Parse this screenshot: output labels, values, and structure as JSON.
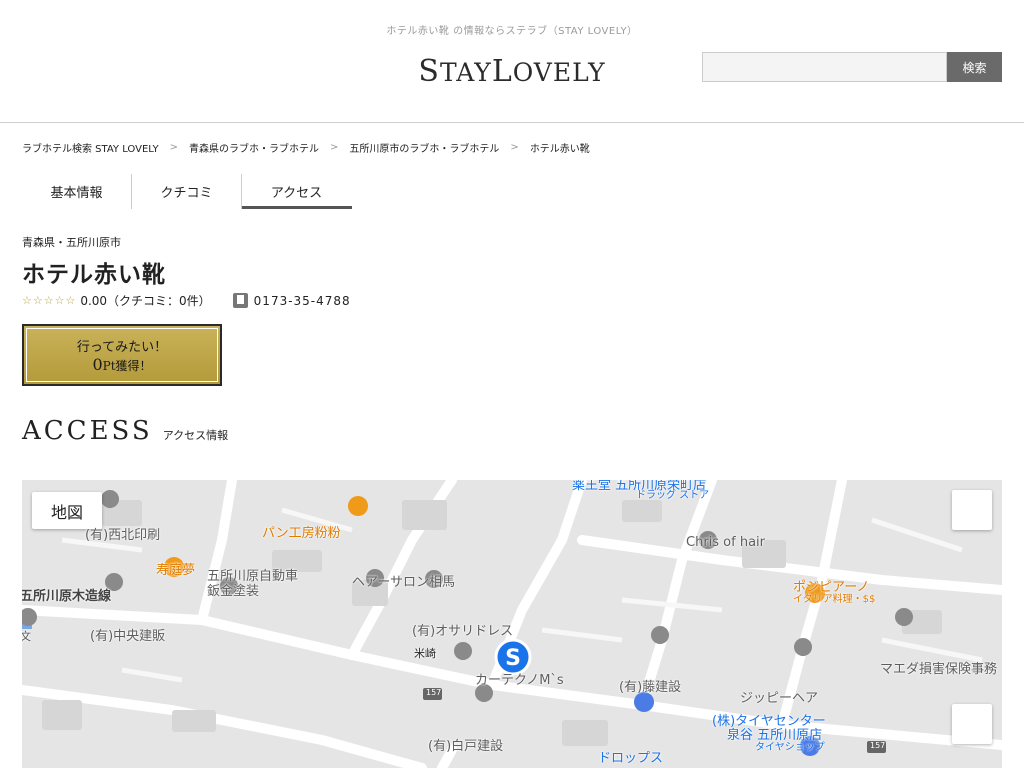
{
  "header": {
    "tagline": "ホテル赤い靴 の情報ならステラブ（STAY LOVELY）",
    "logo_first": "S",
    "logo_mid": "TAY",
    "logo_second": "L",
    "logo_rest": "OVELY",
    "search_placeholder": "",
    "search_button": "検索"
  },
  "breadcrumb": [
    "ラブホテル検索 STAY LOVELY",
    "青森県のラブホ・ラブホテル",
    "五所川原市のラブホ・ラブホテル",
    "ホテル赤い靴"
  ],
  "breadcrumb_sep": ">",
  "tabs": [
    "基本情報",
    "クチコミ",
    "アクセス"
  ],
  "hotel": {
    "prefecture": "青森県・五所川原市",
    "name": "ホテル赤い靴",
    "stars": "☆☆☆☆☆",
    "rating": "0.00（クチコミ：0件）",
    "phone": "0173-35-4788"
  },
  "want_button": {
    "line1": "行ってみたい！",
    "points": "0",
    "points_suffix": "Pt獲得！"
  },
  "access": {
    "title_en": "ACCESS",
    "title_ja": "アクセス情報"
  },
  "map": {
    "type_button": "地図",
    "labels": {
      "nishikita": "(有)西北印刷",
      "pan": "パン工房粉粉",
      "jukoumu": "寿庭夢",
      "goshogawara_auto1": "五所川原自動車",
      "goshogawara_auto2": "鈑金塗装",
      "hair_salon": "ヘアーサロン相馬",
      "osari": "(有)オサリドレス",
      "yonezaki": "米崎",
      "car_techno": "カーテクノM`s",
      "chuo": "(有)中央建販",
      "shirato": "(有)白戸建設",
      "fuji": "(有)藤建設",
      "chris": "Chris of hair",
      "pozipiano": "ポジピアーノ",
      "italian": "イタリア料理・$$",
      "maeda": "マエダ損害保険事務",
      "gippy": "ジッピーヘア",
      "tire1": "(株)タイヤセンター",
      "tire2": "泉谷 五所川原店",
      "tire3": "タイヤショップ",
      "drops": "ドロップス",
      "drug1": "薬王堂 五所川原栄町店",
      "drug2": "ドラッグ ストア",
      "road": "五所川原木造線",
      "route": "157",
      "route2": "157",
      "bun": "文"
    }
  }
}
